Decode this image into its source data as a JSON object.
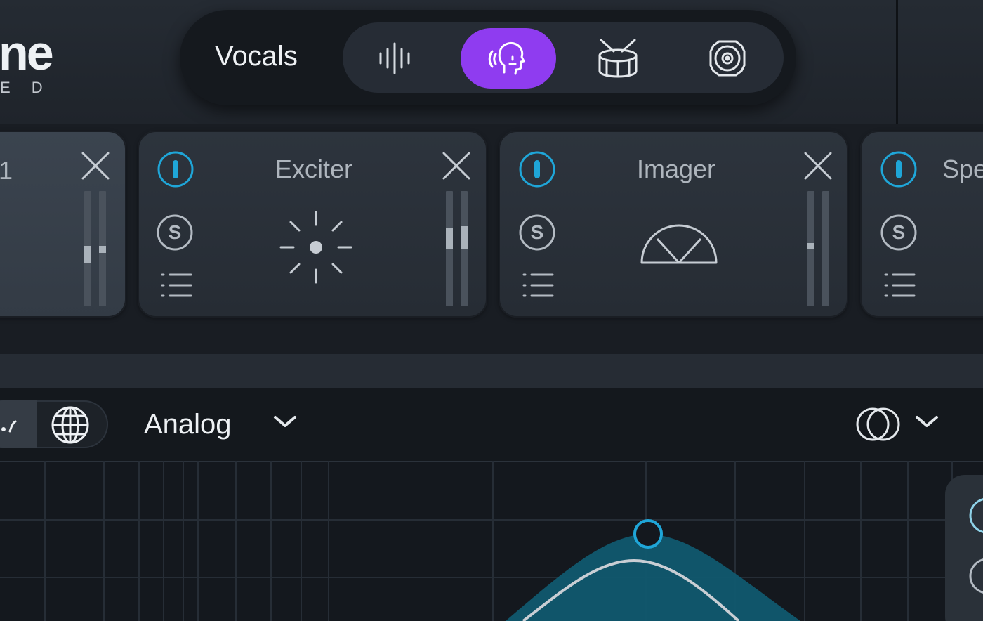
{
  "header": {
    "logo_text": "ne",
    "logo_subtext": "E D",
    "assistant": {
      "label": "Vocals",
      "types": [
        {
          "name": "waveform",
          "icon": "waveform-icon",
          "active": false
        },
        {
          "name": "vocals",
          "icon": "voice-head-icon",
          "active": true
        },
        {
          "name": "drums",
          "icon": "drum-icon",
          "active": false
        },
        {
          "name": "speaker",
          "icon": "speaker-icon",
          "active": false
        }
      ],
      "active_color": "#8f3cf0"
    }
  },
  "modules": [
    {
      "title": "1",
      "icon": "",
      "selected": true
    },
    {
      "title": "Exciter",
      "icon": "exciter-icon",
      "selected": false
    },
    {
      "title": "Imager",
      "icon": "imager-icon",
      "selected": false
    },
    {
      "title": "Spe",
      "icon": "",
      "selected": false
    }
  ],
  "module_labels": {
    "solo": "S"
  },
  "eq_toolbar": {
    "mode_label": "Analog",
    "mode_options_icon": "chevron-down-icon",
    "stereo_icon": "stereo-rings-icon"
  },
  "colors": {
    "accent_blue": "#1fa6d8",
    "eq_fill": "#10586f"
  }
}
